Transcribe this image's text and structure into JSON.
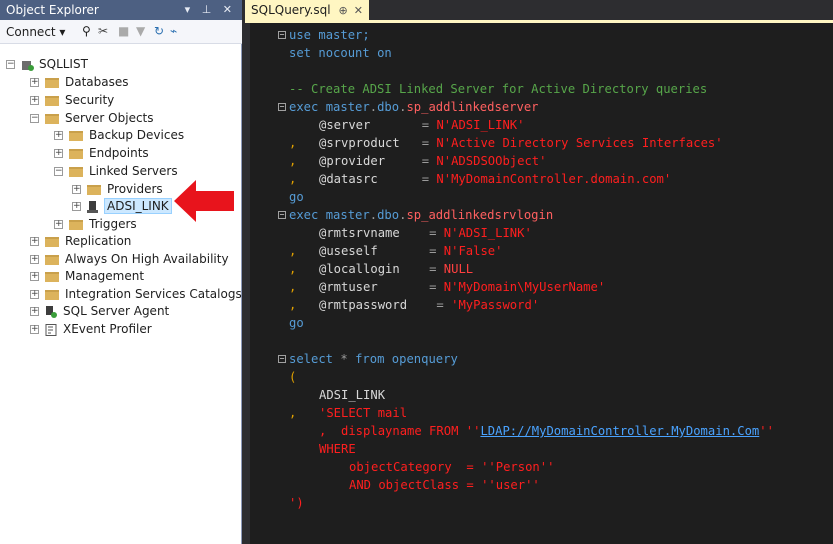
{
  "object_explorer": {
    "title": "Object Explorer",
    "title_controls": "▾ ⊥ ✕",
    "connect_label": "Connect ▾",
    "root": "SQLLIST",
    "items": [
      {
        "label": "Databases"
      },
      {
        "label": "Security"
      },
      {
        "label": "Server Objects"
      },
      {
        "label": "Backup Devices"
      },
      {
        "label": "Endpoints"
      },
      {
        "label": "Linked Servers"
      },
      {
        "label": "Providers"
      },
      {
        "label": "ADSI_LINK"
      },
      {
        "label": "Triggers"
      },
      {
        "label": "Replication"
      },
      {
        "label": "Always On High Availability"
      },
      {
        "label": "Management"
      },
      {
        "label": "Integration Services Catalogs"
      },
      {
        "label": "SQL Server Agent"
      },
      {
        "label": "XEvent Profiler"
      }
    ]
  },
  "editor": {
    "tab_label": "SQLQuery.sql",
    "tab_pin": "⊕",
    "tab_close": "✕",
    "lines": [
      {
        "parts": [
          "use",
          " ",
          "master;"
        ]
      },
      {
        "parts": [
          "set",
          " ",
          "nocount",
          " ",
          "on"
        ]
      },
      {
        "parts": [
          ""
        ]
      },
      {
        "parts": [
          "-- Create ADSI Linked Server for Active Directory queries"
        ]
      },
      {
        "parts": [
          "exec",
          " ",
          "master",
          ".",
          "dbo",
          ".",
          "sp_addlinkedserver"
        ]
      },
      {
        "parts": [
          "@server",
          "       ",
          "=",
          " ",
          "N'ADSI_LINK'"
        ]
      },
      {
        "parts": [
          "@srvproduct",
          "   ",
          "=",
          " ",
          "N'Active Directory Services Interfaces'"
        ]
      },
      {
        "parts": [
          "@provider",
          "     ",
          "=",
          " ",
          "N'ADSDSOObject'"
        ]
      },
      {
        "parts": [
          "@datasrc",
          "      ",
          "=",
          " ",
          "N'MyDomainController.domain.com'"
        ]
      },
      {
        "parts": [
          "go"
        ]
      },
      {
        "parts": [
          "exec",
          " ",
          "master",
          ".",
          "dbo",
          ".",
          "sp_addlinkedsrvlogin"
        ]
      },
      {
        "parts": [
          "@rmtsrvname",
          "    ",
          "=",
          " ",
          "N'ADSI_LINK'"
        ]
      },
      {
        "parts": [
          "@useself",
          "       ",
          "=",
          " ",
          "N'False'"
        ]
      },
      {
        "parts": [
          "@locallogin",
          "    ",
          "=",
          " ",
          "NULL"
        ]
      },
      {
        "parts": [
          "@rmtuser",
          "       ",
          "=",
          " ",
          "N'MyDomain\\MyUserName'"
        ]
      },
      {
        "parts": [
          "@rmtpassword",
          "    ",
          "=",
          " ",
          "'MyPassword'"
        ]
      },
      {
        "parts": [
          "go"
        ]
      },
      {
        "parts": [
          ""
        ]
      },
      {
        "parts": [
          "select",
          " ",
          "*",
          " ",
          "from",
          " ",
          "openquery"
        ]
      },
      {
        "parts": [
          "("
        ]
      },
      {
        "parts": [
          "ADSI_LINK"
        ]
      },
      {
        "parts": [
          "'SELECT mail"
        ]
      },
      {
        "parts": [
          ",  displayname FROM ''",
          "LDAP://MyDomainController.MyDomain.Com",
          "''"
        ]
      },
      {
        "parts": [
          "WHERE"
        ]
      },
      {
        "parts": [
          "objectCategory  = ''Person''"
        ]
      },
      {
        "parts": [
          "AND objectClass = ''user''"
        ]
      },
      {
        "parts": [
          "')"
        ]
      }
    ],
    "commas": [
      ",",
      ",",
      ",",
      ",",
      ",",
      ",",
      ",",
      ","
    ]
  },
  "colors": {
    "keyword": "#569cd6",
    "comment": "#57a64a",
    "string": "#ff1f1f",
    "operator": "#9b9b9b",
    "panel_title": "#4d6082",
    "tab_active": "#fff6c2",
    "arrow": "#e8141c"
  }
}
